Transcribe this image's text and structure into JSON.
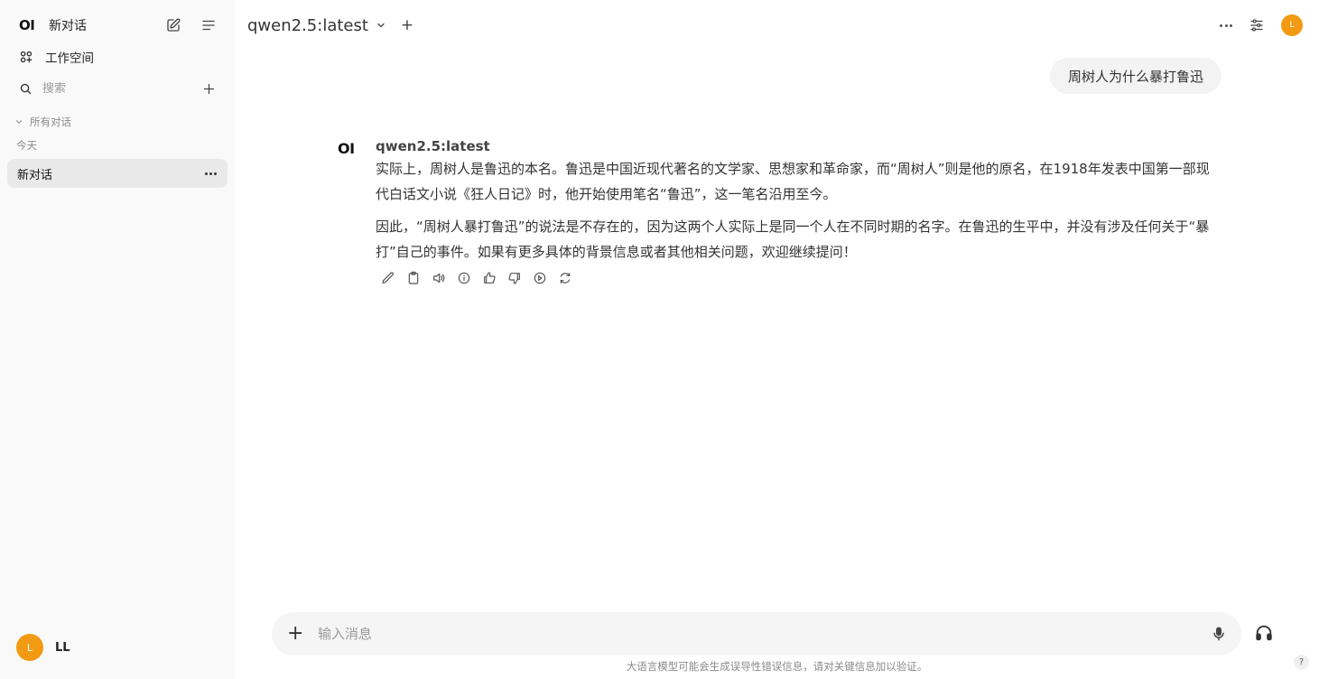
{
  "sidebar": {
    "logo": "OI",
    "new_chat_label": "新对话",
    "workspace_label": "工作空间",
    "search_placeholder": "搜索",
    "section_label": "所有对话",
    "today_label": "今天",
    "chats": [
      {
        "title": "新对话"
      }
    ],
    "user": {
      "avatar_letter": "L",
      "name": "LL"
    }
  },
  "header": {
    "model_name": "qwen2.5:latest",
    "avatar_letter": "L"
  },
  "conversation": {
    "user_message": "周树人为什么暴打鲁迅",
    "assistant": {
      "logo": "OI",
      "model_name": "qwen2.5:latest",
      "paragraphs": [
        "实际上，周树人是鲁迅的本名。鲁迅是中国近现代著名的文学家、思想家和革命家，而“周树人”则是他的原名，在1918年发表中国第一部现代白话文小说《狂人日记》时，他开始使用笔名“鲁迅”，这一笔名沿用至今。",
        "因此，“周树人暴打鲁迅”的说法是不存在的，因为这两个人实际上是同一个人在不同时期的名字。在鲁迅的生平中，并没有涉及任何关于“暴打”自己的事件。如果有更多具体的背景信息或者其他相关问题，欢迎继续提问！"
      ]
    }
  },
  "composer": {
    "placeholder": "输入消息",
    "value": ""
  },
  "footer": {
    "disclaimer": "大语言模型可能会生成误导性错误信息，请对关键信息加以验证。",
    "help": "?"
  },
  "colors": {
    "sidebar_bg": "#f9f9f9",
    "active_chat_bg": "#e9e9e9",
    "avatar": "#f29a12",
    "bubble_bg": "#f3f3f3"
  }
}
